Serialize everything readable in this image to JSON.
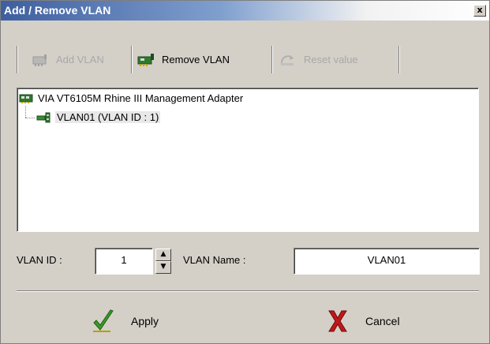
{
  "window": {
    "title": "Add / Remove VLAN",
    "close_glyph": "x"
  },
  "toolbar": {
    "add_label": "Add VLAN",
    "remove_label": "Remove VLAN",
    "reset_label": "Reset value",
    "add_icon": "network-card-add-icon",
    "remove_icon": "network-card-remove-icon",
    "reset_icon": "reset-icon"
  },
  "tree": {
    "adapter_label": "VIA VT6105M Rhine III Management Adapter",
    "adapter_icon": "network-adapter-icon",
    "vlan_label": "VLAN01 (VLAN ID : 1)",
    "vlan_icon": "vlan-icon"
  },
  "form": {
    "vlan_id_label": "VLAN ID :",
    "vlan_id_value": "1",
    "vlan_name_label": "VLAN Name :",
    "vlan_name_value": "VLAN01",
    "spin_up": "▲",
    "spin_down": "▼"
  },
  "actions": {
    "apply_label": "Apply",
    "cancel_label": "Cancel",
    "apply_icon": "checkmark-icon",
    "cancel_icon": "red-x-icon"
  },
  "colors": {
    "title_blue": "#3e5f9f",
    "dialog_gray": "#d4d0c8",
    "apply_green": "#3a9a2a",
    "cancel_red": "#c01818"
  }
}
